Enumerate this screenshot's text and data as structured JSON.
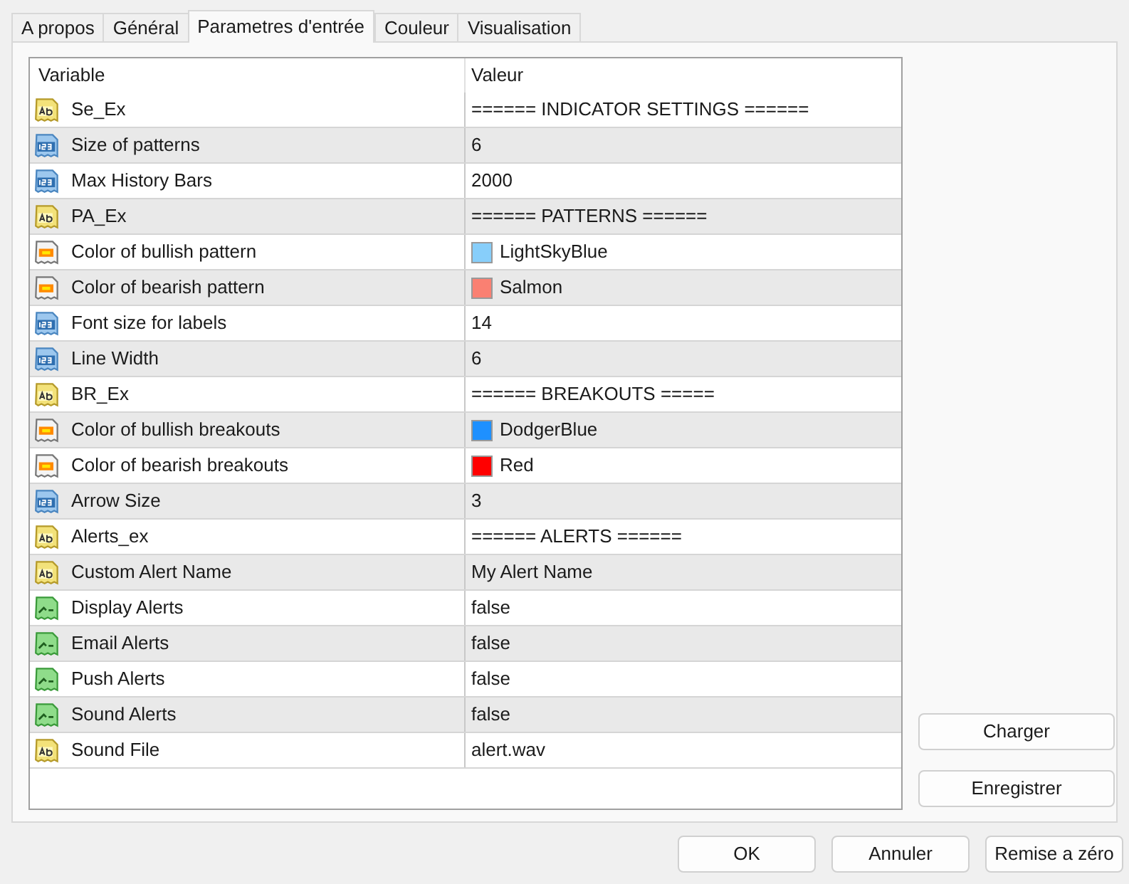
{
  "tabs": [
    {
      "label": "A propos",
      "selected": false
    },
    {
      "label": "Général",
      "selected": false
    },
    {
      "label": "Parametres d'entrée",
      "selected": true
    },
    {
      "label": "Couleur",
      "selected": false
    },
    {
      "label": "Visualisation",
      "selected": false
    }
  ],
  "table": {
    "columns": [
      "Variable",
      "Valeur"
    ],
    "rows": [
      {
        "kind": "string",
        "variable": "Se_Ex",
        "value": "====== INDICATOR SETTINGS ======"
      },
      {
        "kind": "int",
        "variable": "Size of patterns",
        "value": "6"
      },
      {
        "kind": "int",
        "variable": "Max History Bars",
        "value": "2000"
      },
      {
        "kind": "string",
        "variable": "PA_Ex",
        "value": "====== PATTERNS ======"
      },
      {
        "kind": "color",
        "variable": "Color of bullish pattern",
        "value": "LightSkyBlue",
        "color": "#87cefa"
      },
      {
        "kind": "color",
        "variable": "Color of bearish pattern",
        "value": "Salmon",
        "color": "#fa8072"
      },
      {
        "kind": "int",
        "variable": "Font size for labels",
        "value": "14"
      },
      {
        "kind": "int",
        "variable": "Line Width",
        "value": "6"
      },
      {
        "kind": "string",
        "variable": "BR_Ex",
        "value": "====== BREAKOUTS ====="
      },
      {
        "kind": "color",
        "variable": "Color of bullish breakouts",
        "value": "DodgerBlue",
        "color": "#1e90ff"
      },
      {
        "kind": "color",
        "variable": "Color of bearish breakouts",
        "value": "Red",
        "color": "#ff0000"
      },
      {
        "kind": "int",
        "variable": "Arrow Size",
        "value": "3"
      },
      {
        "kind": "string",
        "variable": "Alerts_ex",
        "value": "====== ALERTS ======"
      },
      {
        "kind": "string",
        "variable": "Custom Alert Name",
        "value": "My Alert Name"
      },
      {
        "kind": "bool",
        "variable": "Display Alerts",
        "value": "false"
      },
      {
        "kind": "bool",
        "variable": "Email Alerts",
        "value": "false"
      },
      {
        "kind": "bool",
        "variable": "Push Alerts",
        "value": "false"
      },
      {
        "kind": "bool",
        "variable": "Sound Alerts",
        "value": "false"
      },
      {
        "kind": "string",
        "variable": "Sound File",
        "value": "alert.wav"
      }
    ]
  },
  "side_buttons": [
    "Charger",
    "Enregistrer"
  ],
  "buttons": [
    "OK",
    "Annuler",
    "Remise a zéro"
  ]
}
